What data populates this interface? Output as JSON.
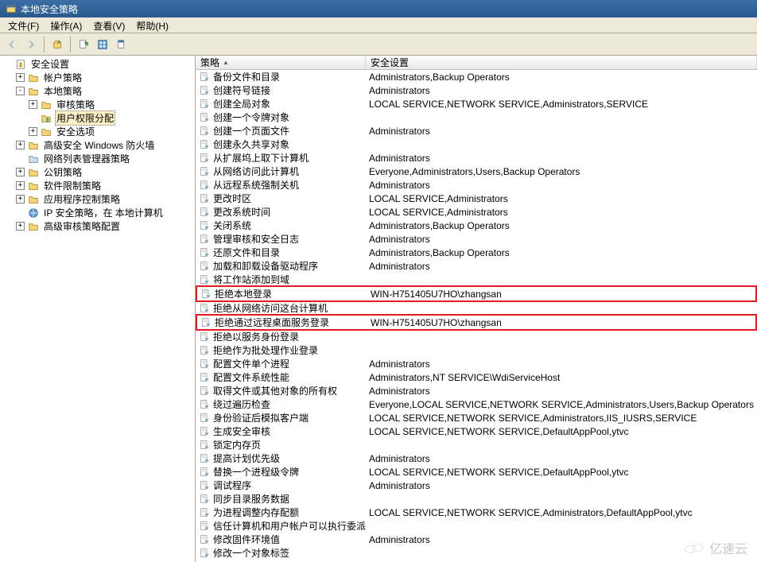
{
  "window": {
    "title": "本地安全策略"
  },
  "menu": {
    "file": "文件(F)",
    "action": "操作(A)",
    "view": "查看(V)",
    "help": "帮助(H)"
  },
  "toolbar": {
    "back": "back",
    "forward": "forward",
    "up": "up",
    "export": "export",
    "refresh": "refresh",
    "help": "help"
  },
  "tree": {
    "root": "安全设置",
    "items": [
      {
        "label": "帐户策略",
        "exp": "+",
        "icon": "folder"
      },
      {
        "label": "本地策略",
        "exp": "-",
        "icon": "folder",
        "children": [
          {
            "label": "审核策略",
            "exp": "+",
            "icon": "folder"
          },
          {
            "label": "用户权限分配",
            "icon": "user-rights",
            "selected": true
          },
          {
            "label": "安全选项",
            "exp": "+",
            "icon": "folder"
          }
        ]
      },
      {
        "label": "高级安全 Windows 防火墙",
        "exp": "+",
        "icon": "folder"
      },
      {
        "label": "网络列表管理器策略",
        "icon": "folder-alt"
      },
      {
        "label": "公钥策略",
        "exp": "+",
        "icon": "folder"
      },
      {
        "label": "软件限制策略",
        "exp": "+",
        "icon": "folder"
      },
      {
        "label": "应用程序控制策略",
        "exp": "+",
        "icon": "folder"
      },
      {
        "label": "IP 安全策略，在 本地计算机",
        "icon": "ip-policy"
      },
      {
        "label": "高级审核策略配置",
        "exp": "+",
        "icon": "folder"
      }
    ]
  },
  "columns": {
    "policy": "策略",
    "setting": "安全设置"
  },
  "policies": [
    {
      "name": "备份文件和目录",
      "setting": "Administrators,Backup Operators"
    },
    {
      "name": "创建符号链接",
      "setting": "Administrators"
    },
    {
      "name": "创建全局对象",
      "setting": "LOCAL SERVICE,NETWORK SERVICE,Administrators,SERVICE"
    },
    {
      "name": "创建一个令牌对象",
      "setting": ""
    },
    {
      "name": "创建一个页面文件",
      "setting": "Administrators"
    },
    {
      "name": "创建永久共享对象",
      "setting": ""
    },
    {
      "name": "从扩展坞上取下计算机",
      "setting": "Administrators"
    },
    {
      "name": "从网络访问此计算机",
      "setting": "Everyone,Administrators,Users,Backup Operators"
    },
    {
      "name": "从远程系统强制关机",
      "setting": "Administrators"
    },
    {
      "name": "更改时区",
      "setting": "LOCAL SERVICE,Administrators"
    },
    {
      "name": "更改系统时间",
      "setting": "LOCAL SERVICE,Administrators"
    },
    {
      "name": "关闭系统",
      "setting": "Administrators,Backup Operators"
    },
    {
      "name": "管理审核和安全日志",
      "setting": "Administrators"
    },
    {
      "name": "还原文件和目录",
      "setting": "Administrators,Backup Operators"
    },
    {
      "name": "加载和卸载设备驱动程序",
      "setting": "Administrators"
    },
    {
      "name": "将工作站添加到域",
      "setting": ""
    },
    {
      "name": "拒绝本地登录",
      "setting": "WIN-H751405U7HO\\zhangsan",
      "hl": true
    },
    {
      "name": "拒绝从网络访问这台计算机",
      "setting": ""
    },
    {
      "name": "拒绝通过远程桌面服务登录",
      "setting": "WIN-H751405U7HO\\zhangsan",
      "hl": true
    },
    {
      "name": "拒绝以服务身份登录",
      "setting": ""
    },
    {
      "name": "拒绝作为批处理作业登录",
      "setting": ""
    },
    {
      "name": "配置文件单个进程",
      "setting": "Administrators"
    },
    {
      "name": "配置文件系统性能",
      "setting": "Administrators,NT SERVICE\\WdiServiceHost"
    },
    {
      "name": "取得文件或其他对象的所有权",
      "setting": "Administrators"
    },
    {
      "name": "绕过遍历检查",
      "setting": "Everyone,LOCAL SERVICE,NETWORK SERVICE,Administrators,Users,Backup Operators"
    },
    {
      "name": "身份验证后模拟客户端",
      "setting": "LOCAL SERVICE,NETWORK SERVICE,Administrators,IIS_IUSRS,SERVICE"
    },
    {
      "name": "生成安全审核",
      "setting": "LOCAL SERVICE,NETWORK SERVICE,DefaultAppPool,ytvc"
    },
    {
      "name": "锁定内存页",
      "setting": ""
    },
    {
      "name": "提高计划优先级",
      "setting": "Administrators"
    },
    {
      "name": "替换一个进程级令牌",
      "setting": "LOCAL SERVICE,NETWORK SERVICE,DefaultAppPool,ytvc"
    },
    {
      "name": "调试程序",
      "setting": "Administrators"
    },
    {
      "name": "同步目录服务数据",
      "setting": ""
    },
    {
      "name": "为进程调整内存配额",
      "setting": "LOCAL SERVICE,NETWORK SERVICE,Administrators,DefaultAppPool,ytvc"
    },
    {
      "name": "信任计算机和用户帐户可以执行委派",
      "setting": ""
    },
    {
      "name": "修改固件环境值",
      "setting": "Administrators"
    },
    {
      "name": "修改一个对象标签",
      "setting": ""
    }
  ],
  "watermark": {
    "text": "亿速云"
  }
}
